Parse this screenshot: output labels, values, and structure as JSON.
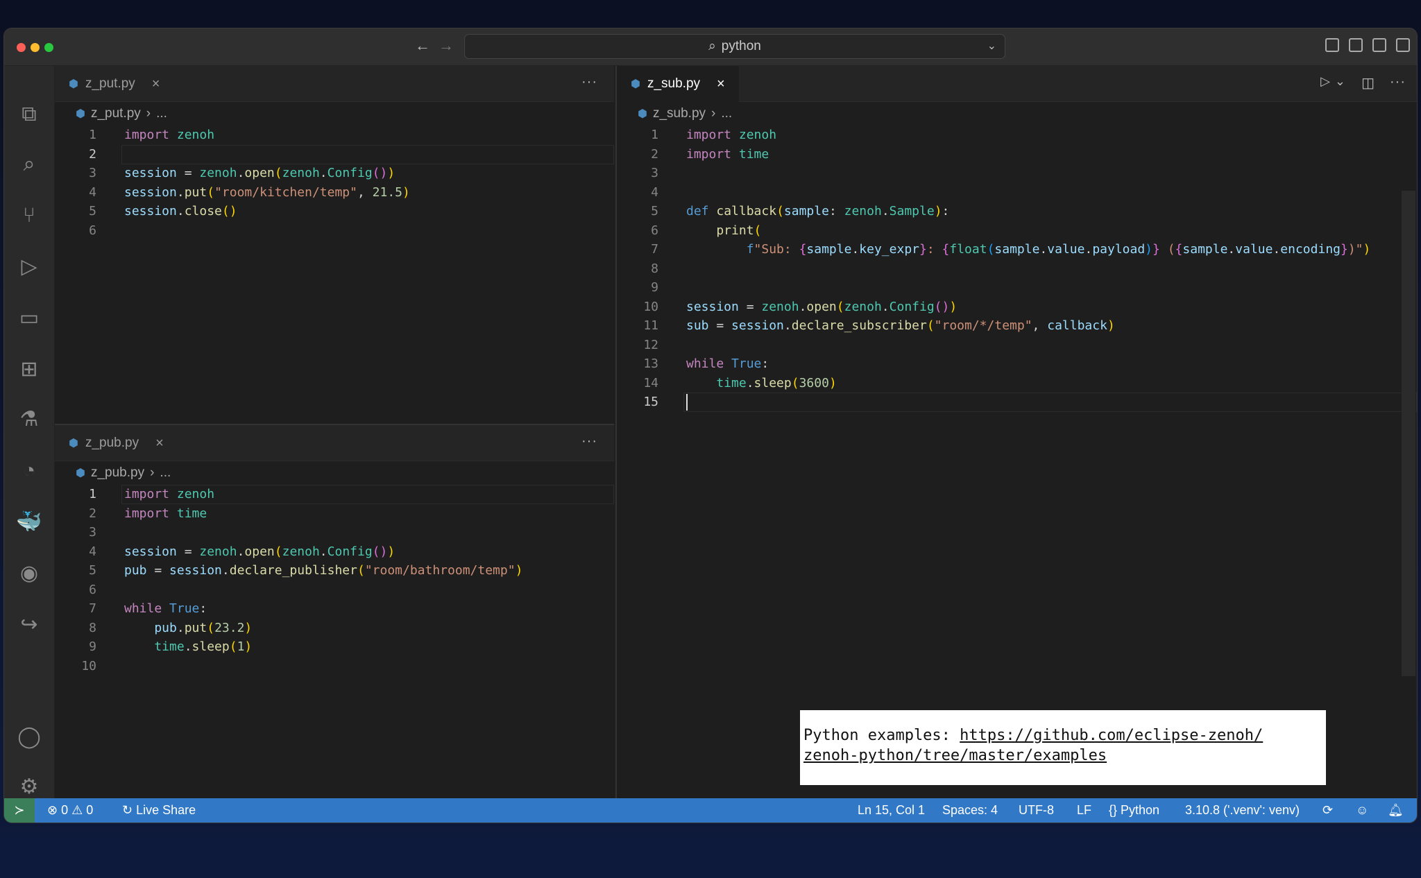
{
  "titlebar": {
    "search": "python"
  },
  "editors": {
    "put": {
      "tab": "z_put.py",
      "crumb": "z_put.py",
      "crumb_more": "...",
      "current_line": 2,
      "lines": [
        [
          [
            "import ",
            "kw"
          ],
          [
            "zenoh",
            "mod"
          ]
        ],
        [],
        [
          [
            "session",
            "var"
          ],
          [
            " = ",
            "pl"
          ],
          [
            "zenoh",
            "mod"
          ],
          [
            ".",
            "pl"
          ],
          [
            "open",
            "fn"
          ],
          [
            "(",
            "b1"
          ],
          [
            "zenoh",
            "mod"
          ],
          [
            ".",
            "pl"
          ],
          [
            "Config",
            "mod"
          ],
          [
            "()",
            "b2"
          ],
          [
            ")",
            "b1"
          ]
        ],
        [
          [
            "session",
            "var"
          ],
          [
            ".",
            "pl"
          ],
          [
            "put",
            "fn"
          ],
          [
            "(",
            "b1"
          ],
          [
            "\"room/kitchen/temp\"",
            "str"
          ],
          [
            ", ",
            "pl"
          ],
          [
            "21.5",
            "nmb"
          ],
          [
            ")",
            "b1"
          ]
        ],
        [
          [
            "session",
            "var"
          ],
          [
            ".",
            "pl"
          ],
          [
            "close",
            "fn"
          ],
          [
            "()",
            "b1"
          ]
        ],
        []
      ]
    },
    "pub": {
      "tab": "z_pub.py",
      "crumb": "z_pub.py",
      "crumb_more": "...",
      "current_line": 1,
      "lines": [
        [
          [
            "import ",
            "kw"
          ],
          [
            "zenoh",
            "mod"
          ]
        ],
        [
          [
            "import ",
            "kw"
          ],
          [
            "time",
            "mod"
          ]
        ],
        [],
        [
          [
            "session",
            "var"
          ],
          [
            " = ",
            "pl"
          ],
          [
            "zenoh",
            "mod"
          ],
          [
            ".",
            "pl"
          ],
          [
            "open",
            "fn"
          ],
          [
            "(",
            "b1"
          ],
          [
            "zenoh",
            "mod"
          ],
          [
            ".",
            "pl"
          ],
          [
            "Config",
            "mod"
          ],
          [
            "()",
            "b2"
          ],
          [
            ")",
            "b1"
          ]
        ],
        [
          [
            "pub",
            "var"
          ],
          [
            " = ",
            "pl"
          ],
          [
            "session",
            "var"
          ],
          [
            ".",
            "pl"
          ],
          [
            "declare_publisher",
            "fn"
          ],
          [
            "(",
            "b1"
          ],
          [
            "\"room/bathroom/temp\"",
            "str"
          ],
          [
            ")",
            "b1"
          ]
        ],
        [],
        [
          [
            "while ",
            "kw"
          ],
          [
            "True",
            "def"
          ],
          [
            ":",
            "pl"
          ]
        ],
        [
          [
            "    pub",
            "var"
          ],
          [
            ".",
            "pl"
          ],
          [
            "put",
            "fn"
          ],
          [
            "(",
            "b1"
          ],
          [
            "23.2",
            "nmb"
          ],
          [
            ")",
            "b1"
          ]
        ],
        [
          [
            "    time",
            "mod"
          ],
          [
            ".",
            "pl"
          ],
          [
            "sleep",
            "fn"
          ],
          [
            "(",
            "b1"
          ],
          [
            "1",
            "nmb"
          ],
          [
            ")",
            "b1"
          ]
        ],
        []
      ]
    },
    "sub": {
      "tab": "z_sub.py",
      "crumb": "z_sub.py",
      "crumb_more": "...",
      "current_line": 15,
      "lines": [
        [
          [
            "import ",
            "kw"
          ],
          [
            "zenoh",
            "mod"
          ]
        ],
        [
          [
            "import ",
            "kw"
          ],
          [
            "time",
            "mod"
          ]
        ],
        [],
        [],
        [
          [
            "def ",
            "def"
          ],
          [
            "callback",
            "fn"
          ],
          [
            "(",
            "b1"
          ],
          [
            "sample",
            "var"
          ],
          [
            ": ",
            "pl"
          ],
          [
            "zenoh",
            "mod"
          ],
          [
            ".",
            "pl"
          ],
          [
            "Sample",
            "mod"
          ],
          [
            ")",
            "b1"
          ],
          [
            ":",
            "pl"
          ]
        ],
        [
          [
            "    print",
            "fn"
          ],
          [
            "(",
            "b1"
          ]
        ],
        [
          [
            "        f",
            "def"
          ],
          [
            "\"Sub: ",
            "str"
          ],
          [
            "{",
            "b2"
          ],
          [
            "sample",
            "var"
          ],
          [
            ".",
            "pl"
          ],
          [
            "key_expr",
            "var"
          ],
          [
            "}",
            "b2"
          ],
          [
            ": ",
            "str"
          ],
          [
            "{",
            "b2"
          ],
          [
            "float",
            "mod"
          ],
          [
            "(",
            "b3"
          ],
          [
            "sample",
            "var"
          ],
          [
            ".",
            "pl"
          ],
          [
            "value",
            "var"
          ],
          [
            ".",
            "pl"
          ],
          [
            "payload",
            "var"
          ],
          [
            ")",
            "b3"
          ],
          [
            "}",
            "b2"
          ],
          [
            " (",
            "str"
          ],
          [
            "{",
            "b2"
          ],
          [
            "sample",
            "var"
          ],
          [
            ".",
            "pl"
          ],
          [
            "value",
            "var"
          ],
          [
            ".",
            "pl"
          ],
          [
            "encoding",
            "var"
          ],
          [
            "}",
            "b2"
          ],
          [
            ")\"",
            "str"
          ],
          [
            ")",
            "b1"
          ]
        ],
        [],
        [],
        [
          [
            "session",
            "var"
          ],
          [
            " = ",
            "pl"
          ],
          [
            "zenoh",
            "mod"
          ],
          [
            ".",
            "pl"
          ],
          [
            "open",
            "fn"
          ],
          [
            "(",
            "b1"
          ],
          [
            "zenoh",
            "mod"
          ],
          [
            ".",
            "pl"
          ],
          [
            "Config",
            "mod"
          ],
          [
            "()",
            "b2"
          ],
          [
            ")",
            "b1"
          ]
        ],
        [
          [
            "sub",
            "var"
          ],
          [
            " = ",
            "pl"
          ],
          [
            "session",
            "var"
          ],
          [
            ".",
            "pl"
          ],
          [
            "declare_subscriber",
            "fn"
          ],
          [
            "(",
            "b1"
          ],
          [
            "\"room/*/temp\"",
            "str"
          ],
          [
            ", ",
            "pl"
          ],
          [
            "callback",
            "var"
          ],
          [
            ")",
            "b1"
          ]
        ],
        [],
        [
          [
            "while ",
            "kw"
          ],
          [
            "True",
            "def"
          ],
          [
            ":",
            "pl"
          ]
        ],
        [
          [
            "    time",
            "mod"
          ],
          [
            ".",
            "pl"
          ],
          [
            "sleep",
            "fn"
          ],
          [
            "(",
            "b1"
          ],
          [
            "3600",
            "nmb"
          ],
          [
            ")",
            "b1"
          ]
        ],
        []
      ]
    }
  },
  "popup": {
    "prefix": "Python examples: ",
    "link_line1": "https://github.com/eclipse-zenoh/",
    "link_line2": "zenoh-python/tree/master/examples"
  },
  "status": {
    "errors": "0",
    "warnings": "0",
    "live_share": "Live Share",
    "position": "Ln 15, Col 1",
    "spaces": "Spaces: 4",
    "encoding": "UTF-8",
    "eol": "LF",
    "language": "Python",
    "interpreter": "3.10.8 ('.venv': venv)"
  }
}
